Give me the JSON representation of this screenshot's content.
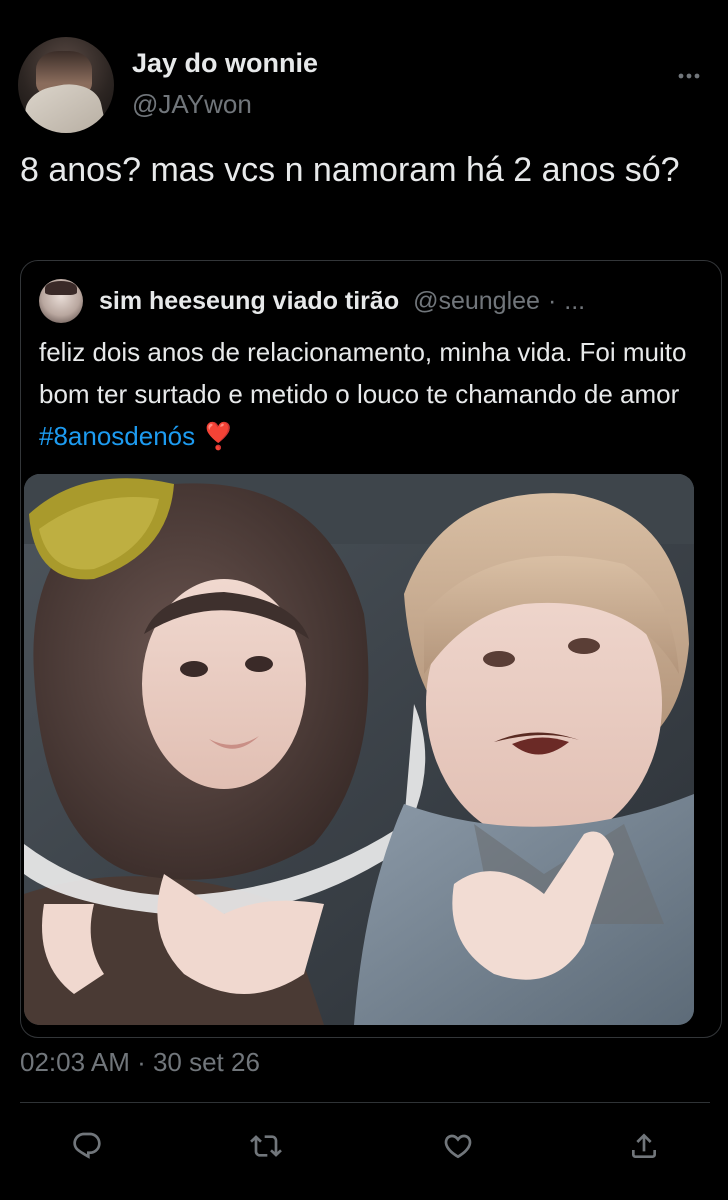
{
  "tweet": {
    "author": {
      "display_name": "Jay do wonnie",
      "handle": "@JAYwon",
      "avatar_icon": "profile-avatar"
    },
    "more_icon": "more-horizontal-icon",
    "text": "8 anos? mas vcs n namoram há 2 anos só?",
    "timestamp": "02:03 AM · 30 set 26"
  },
  "quoted_tweet": {
    "display_name": "sim heeseung viado tirão",
    "handle": "@seunglee",
    "separator": "·",
    "more": "...",
    "text": "feliz dois anos de relacionamento, minha vida. Foi muito bom ter surtado e metido o louco te chamando de amor ",
    "hashtag": "#8anosdenós",
    "emoji": "❣️",
    "media": {
      "type": "photo"
    }
  },
  "actions": [
    {
      "name": "reply",
      "icon": "reply-icon"
    },
    {
      "name": "retweet",
      "icon": "retweet-icon"
    },
    {
      "name": "like",
      "icon": "heart-icon"
    },
    {
      "name": "share",
      "icon": "share-icon"
    }
  ],
  "colors": {
    "background": "#000000",
    "text_primary": "#e7e9ea",
    "text_secondary": "#71767b",
    "link": "#1d9bf0",
    "border": "#333639",
    "emoji_heart": "#e0245e"
  }
}
